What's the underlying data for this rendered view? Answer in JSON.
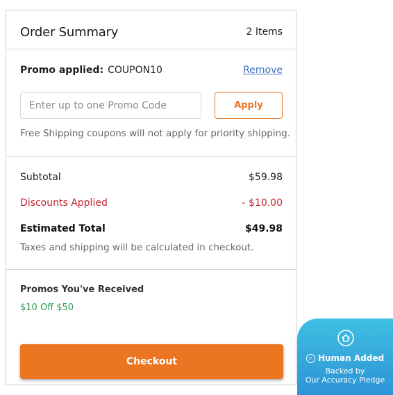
{
  "summary": {
    "title": "Order Summary",
    "count": "2 Items"
  },
  "promo": {
    "applied_label": "Promo applied:",
    "applied_code": "COUPON10",
    "remove_label": "Remove",
    "input_placeholder": "Enter up to one Promo Code",
    "input_value": "",
    "apply_label": "Apply",
    "shipping_note": "Free Shipping coupons will not apply for priority shipping."
  },
  "totals": {
    "subtotal_label": "Subtotal",
    "subtotal_value": "$59.98",
    "discount_label": "Discounts Applied",
    "discount_value": "- $10.00",
    "estimated_label": "Estimated Total",
    "estimated_value": "$49.98",
    "tax_note": "Taxes and shipping will be calculated in checkout."
  },
  "received": {
    "heading": "Promos You've Received",
    "items": [
      "$10 Off $50"
    ]
  },
  "checkout": {
    "label": "Checkout"
  },
  "badge": {
    "title": "Human Added",
    "line2": "Backed by",
    "line3": "Our Accuracy Pledge"
  },
  "colors": {
    "accent": "#ec7521",
    "discount": "#c1272d",
    "promo_green": "#2a9d4b",
    "link": "#3b6fbf",
    "badge": "#2e93d6"
  }
}
